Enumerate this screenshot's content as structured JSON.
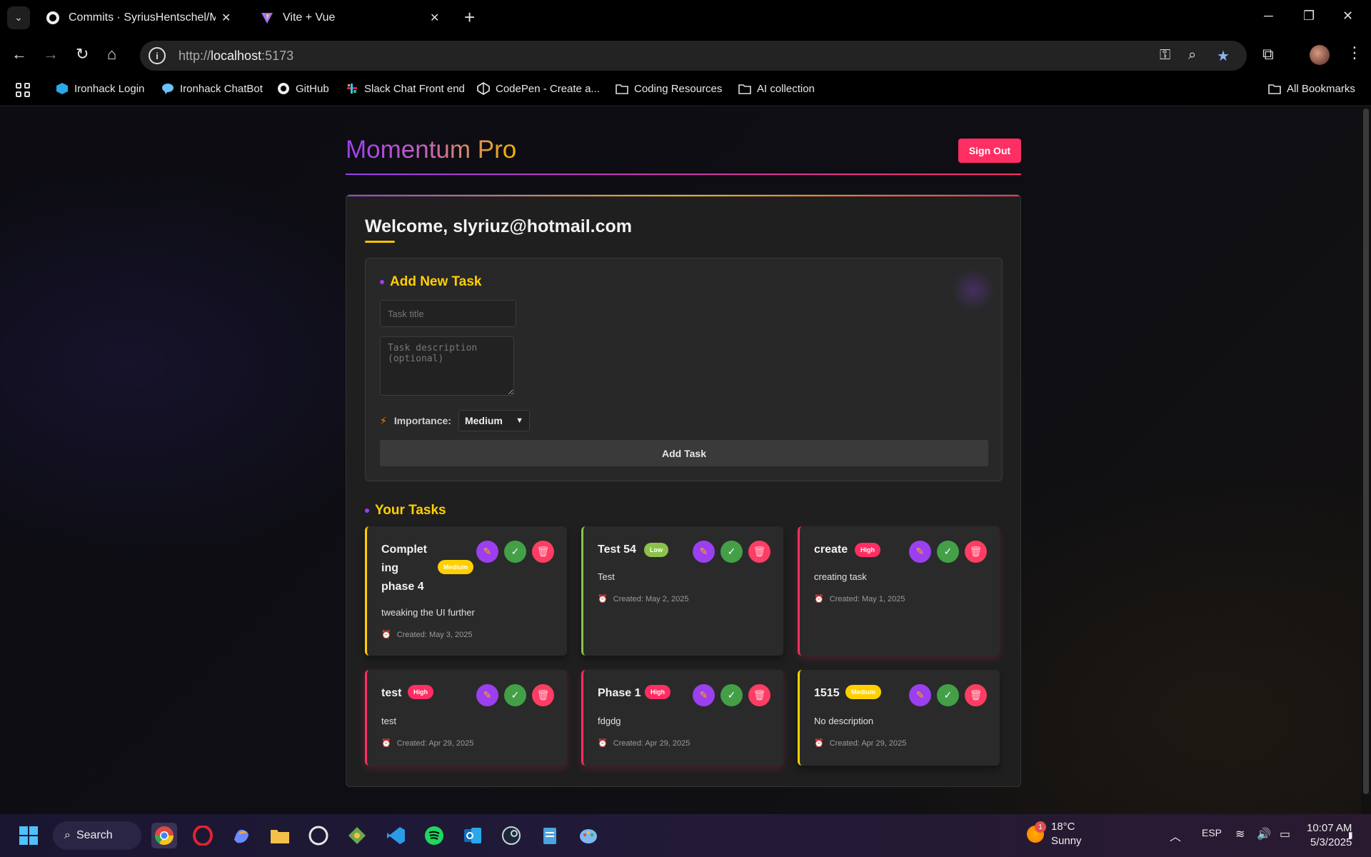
{
  "browser": {
    "tabs": [
      {
        "title": "Commits · SyriusHentschel/Momentum",
        "icon": "github-icon"
      },
      {
        "title": "Vite + Vue",
        "icon": "vite-icon"
      }
    ],
    "url_scheme": "http://",
    "url_host": "localhost",
    "url_port": ":5173",
    "bookmarks": [
      {
        "label": "Ironhack Login",
        "icon": "ironhack-icon"
      },
      {
        "label": "Ironhack ChatBot",
        "icon": "chat-icon"
      },
      {
        "label": "GitHub",
        "icon": "github-icon"
      },
      {
        "label": "Slack Chat Front end",
        "icon": "slack-icon"
      },
      {
        "label": "CodePen - Create a...",
        "icon": "codepen-icon"
      },
      {
        "label": "Coding Resources",
        "icon": "folder-icon"
      },
      {
        "label": "AI collection",
        "icon": "folder-icon"
      }
    ],
    "all_bookmarks": "All Bookmarks"
  },
  "app": {
    "title": "Momentum Pro",
    "sign_out": "Sign Out",
    "welcome": "Welcome, slyriuz@hotmail.com",
    "add_section_title": "Add New Task",
    "task_title_placeholder": "Task title",
    "task_desc_placeholder": "Task description (optional)",
    "importance_label": "Importance:",
    "importance_value": "Medium",
    "add_task_label": "Add Task",
    "tasks_section_title": "Your Tasks",
    "colors": {
      "purple": "#9b3ff0",
      "gold": "#ffd000",
      "pink": "#ff2e63",
      "green": "#43a047",
      "low": "#8bc34a"
    }
  },
  "tasks": [
    {
      "title": "Completing phase 4",
      "title_lines": [
        "Complet",
        "ing",
        "phase 4"
      ],
      "priority": "Medium",
      "description": "tweaking the UI further",
      "created": "Created: May 3, 2025"
    },
    {
      "title": "Test 54",
      "priority": "Low",
      "description": "Test",
      "created": "Created: May 2, 2025"
    },
    {
      "title": "create",
      "priority": "High",
      "description": "creating task",
      "created": "Created: May 1, 2025"
    },
    {
      "title": "test",
      "priority": "High",
      "description": "test",
      "created": "Created: Apr 29, 2025"
    },
    {
      "title": "Phase 1",
      "priority": "High",
      "description": "fdgdg",
      "created": "Created: Apr 29, 2025"
    },
    {
      "title": "1515",
      "priority": "Medium",
      "description": "No description",
      "created": "Created: Apr 29, 2025"
    }
  ],
  "taskbar": {
    "search": "Search",
    "weather_temp": "18°C",
    "weather_cond": "Sunny",
    "weather_badge": "1",
    "lang": "ESP",
    "time": "10:07 AM",
    "date": "5/3/2025"
  }
}
